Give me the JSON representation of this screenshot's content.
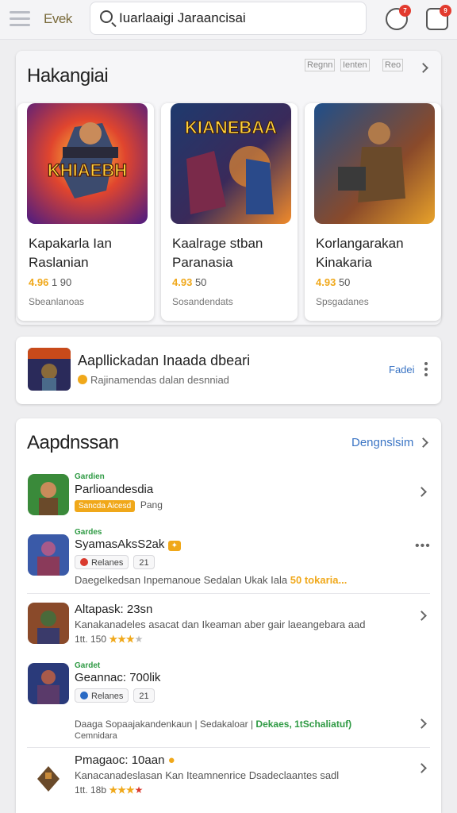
{
  "header": {
    "brand": "Evek",
    "search_value": "Iuarlaaigi Jaraancisai",
    "notif_badge": "7",
    "gift_badge": "9",
    "icons": [
      "menu-icon",
      "search-icon",
      "notification-icon",
      "gift-icon"
    ]
  },
  "featured": {
    "title": "Hakangiai",
    "chips": [
      "Regnn",
      "Ienten",
      "Reo"
    ],
    "games": [
      {
        "art_text": "KHIAEBH",
        "name_line1": "Kapakarla Ian",
        "name_line2": "Raslanian",
        "rating_label": "4.96",
        "rating_value": "1 90",
        "subtitle": "Sbeanlanoas",
        "bg": "#7a2a9a",
        "bg2": "#e0452e"
      },
      {
        "art_text": "KIANEBAA",
        "name_line1": "Kaalrage stban",
        "name_line2": "Paranasia",
        "rating_label": "4.93",
        "rating_value": "50",
        "subtitle": "Sosandendats",
        "bg": "#1e3a6e",
        "bg2": "#f08a2a"
      },
      {
        "art_text": "",
        "name_line1": "Korlangarakan",
        "name_line2": "Kinakaria",
        "rating_label": "4.93",
        "rating_value": "50",
        "subtitle": "Spsgadanes",
        "bg": "#1f4f8a",
        "bg2": "#e8a22a"
      }
    ]
  },
  "banner": {
    "title": "Aapllickadan Inaada dbeari",
    "subtitle": "Rajinamendas dalan desnniad",
    "link": "Fadei"
  },
  "list": {
    "title": "Aapdnssan",
    "link": "Dengnslsim",
    "rows": [
      {
        "category": "Gardien",
        "name": "Parlioandesdia",
        "tag": "Sancda Aicesd",
        "meta": "Pang"
      },
      {
        "category": "Gardes",
        "name": "SyamasAksS2ak",
        "pill1": "Relanes",
        "pill2": "21",
        "desc": "Daegelkedsan Inpemanoue Sedalan Ukak Iala",
        "desc_hl": "50 tokaria..."
      },
      {
        "category": "",
        "name": "Altapask: 23sn",
        "desc": "Kanakanadeles asacat dan Ikeaman aber gair laeangebara aad",
        "rating": "1tt. 150"
      },
      {
        "category": "Gardet",
        "name": "Geannac: 700lik",
        "pill1": "Relanes",
        "pill2": "21",
        "desc": "Daaga Sopaajakandenkaun | Sedakaloar |",
        "desc_hl_green": "Dekaes, 1tSchaliatuf)",
        "desc2": "Cemnidara"
      },
      {
        "category": "",
        "name": "Pmagaoc: 10aan",
        "desc": "Kanacanadeslasan Kan Iteamnenrice Dsadeclaantes sadl",
        "rating": "1tt. 18b"
      }
    ]
  },
  "colors": {
    "accent_blue": "#3a74c4",
    "star_orange": "#f0a81a",
    "category_green": "#2f9a44",
    "badge_red": "#e23a2e"
  }
}
